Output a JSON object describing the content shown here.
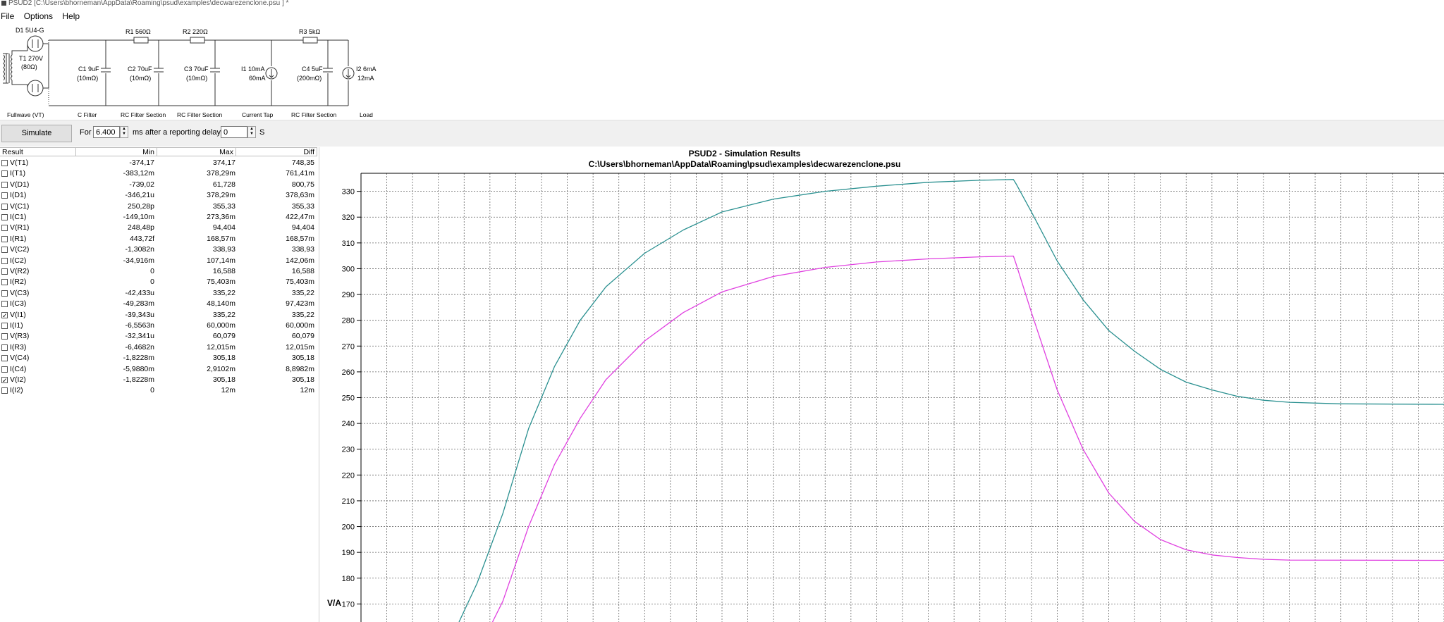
{
  "window": {
    "title": "PSUD2  [C:\\Users\\bhorneman\\AppData\\Roaming\\psud\\examples\\decwarezenclone.psu ] *"
  },
  "menu": [
    "File",
    "Options",
    "Help"
  ],
  "schematic": {
    "components": {
      "d1": "D1 5U4-G",
      "t1_a": "T1 270V",
      "t1_b": "(80Ω)",
      "r1": "R1 560Ω",
      "r2": "R2 220Ω",
      "r3": "R3 5kΩ",
      "c1_a": "C1 9uF",
      "c1_b": "(10mΩ)",
      "c2_a": "C2 70uF",
      "c2_b": "(10mΩ)",
      "c3_a": "C3 70uF",
      "c3_b": "(10mΩ)",
      "i1_a": "I1 10mA",
      "i1_b": "60mA",
      "c4_a": "C4 5uF",
      "c4_b": "(200mΩ)",
      "i2_a": "I2 6mA",
      "i2_b": "12mA"
    },
    "sections": {
      "s1": "Fullwave (VT)",
      "s2": "C Filter",
      "s3": "RC Filter Section",
      "s4": "RC Filter Section",
      "s5": "Current Tap",
      "s6": "RC Filter Section",
      "s7": "Load"
    }
  },
  "toolbar": {
    "simulate_label": "Simulate",
    "for_label": "For",
    "duration": "6.400",
    "ms_label": "ms",
    "after_label": "after a reporting delay of",
    "delay": "0",
    "s_label": "S"
  },
  "results": {
    "headers": {
      "result": "Result",
      "min": "Min",
      "max": "Max",
      "diff": "Diff"
    },
    "rows": [
      {
        "name": "V(T1)",
        "min": "-374,17",
        "max": "374,17",
        "diff": "748,35",
        "checked": false
      },
      {
        "name": "I(T1)",
        "min": "-383,12m",
        "max": "378,29m",
        "diff": "761,41m",
        "checked": false
      },
      {
        "name": "V(D1)",
        "min": "-739,02",
        "max": "61,728",
        "diff": "800,75",
        "checked": false
      },
      {
        "name": "I(D1)",
        "min": "-346,21u",
        "max": "378,29m",
        "diff": "378,63m",
        "checked": false
      },
      {
        "name": "V(C1)",
        "min": "250,28p",
        "max": "355,33",
        "diff": "355,33",
        "checked": false
      },
      {
        "name": "I(C1)",
        "min": "-149,10m",
        "max": "273,36m",
        "diff": "422,47m",
        "checked": false
      },
      {
        "name": "V(R1)",
        "min": "248,48p",
        "max": "94,404",
        "diff": "94,404",
        "checked": false
      },
      {
        "name": "I(R1)",
        "min": "443,72f",
        "max": "168,57m",
        "diff": "168,57m",
        "checked": false
      },
      {
        "name": "V(C2)",
        "min": "-1,3082n",
        "max": "338,93",
        "diff": "338,93",
        "checked": false
      },
      {
        "name": "I(C2)",
        "min": "-34,916m",
        "max": "107,14m",
        "diff": "142,06m",
        "checked": false
      },
      {
        "name": "V(R2)",
        "min": "0",
        "max": "16,588",
        "diff": "16,588",
        "checked": false
      },
      {
        "name": "I(R2)",
        "min": "0",
        "max": "75,403m",
        "diff": "75,403m",
        "checked": false
      },
      {
        "name": "V(C3)",
        "min": "-42,433u",
        "max": "335,22",
        "diff": "335,22",
        "checked": false
      },
      {
        "name": "I(C3)",
        "min": "-49,283m",
        "max": "48,140m",
        "diff": "97,423m",
        "checked": false
      },
      {
        "name": "V(I1)",
        "min": "-39,343u",
        "max": "335,22",
        "diff": "335,22",
        "checked": true
      },
      {
        "name": "I(I1)",
        "min": "-6,5563n",
        "max": "60,000m",
        "diff": "60,000m",
        "checked": false
      },
      {
        "name": "V(R3)",
        "min": "-32,341u",
        "max": "60,079",
        "diff": "60,079",
        "checked": false
      },
      {
        "name": "I(R3)",
        "min": "-6,4682n",
        "max": "12,015m",
        "diff": "12,015m",
        "checked": false
      },
      {
        "name": "V(C4)",
        "min": "-1,8228m",
        "max": "305,18",
        "diff": "305,18",
        "checked": false
      },
      {
        "name": "I(C4)",
        "min": "-5,9880m",
        "max": "2,9102m",
        "diff": "8,8982m",
        "checked": false
      },
      {
        "name": "V(I2)",
        "min": "-1,8228m",
        "max": "305,18",
        "diff": "305,18",
        "checked": true
      },
      {
        "name": "I(I2)",
        "min": "0",
        "max": "12m",
        "diff": "12m",
        "checked": false
      }
    ]
  },
  "plot": {
    "title": "PSUD2 - Simulation Results",
    "subtitle": "C:\\Users\\bhorneman\\AppData\\Roaming\\psud\\examples\\decwarezenclone.psu",
    "ylabel": "V/A"
  },
  "chart_data": {
    "type": "line",
    "title": "PSUD2 - Simulation Results",
    "subtitle": "C:\\Users\\bhorneman\\AppData\\Roaming\\psud\\examples\\decwarezenclone.psu",
    "ylabel": "V/A",
    "xlabel": "",
    "ylim": [
      163,
      337
    ],
    "y_ticks": [
      170,
      180,
      190,
      200,
      210,
      220,
      230,
      240,
      250,
      260,
      270,
      280,
      290,
      300,
      310,
      320,
      330
    ],
    "x_unit_note": "",
    "grid": true,
    "xlim": [
      0,
      42
    ],
    "series": [
      {
        "name": "V(I1)",
        "color": "#2a9090",
        "points": [
          [
            3.8,
            163
          ],
          [
            4.5,
            178
          ],
          [
            5.5,
            205
          ],
          [
            6.5,
            238
          ],
          [
            7.5,
            262
          ],
          [
            8.5,
            280
          ],
          [
            9.5,
            293
          ],
          [
            11,
            306
          ],
          [
            12.5,
            315
          ],
          [
            14,
            322
          ],
          [
            16,
            327
          ],
          [
            18,
            330
          ],
          [
            20,
            332
          ],
          [
            22,
            333.5
          ],
          [
            24,
            334.3
          ],
          [
            25.3,
            334.6
          ],
          [
            25.4,
            333
          ],
          [
            26,
            322
          ],
          [
            27,
            303
          ],
          [
            28,
            288
          ],
          [
            29,
            276
          ],
          [
            30,
            268
          ],
          [
            31,
            261
          ],
          [
            32,
            256
          ],
          [
            33,
            253
          ],
          [
            34,
            250.5
          ],
          [
            35,
            249
          ],
          [
            36,
            248.2
          ],
          [
            38,
            247.6
          ],
          [
            42,
            247.4
          ]
        ]
      },
      {
        "name": "V(I2)",
        "color": "#e040e0",
        "points": [
          [
            5.1,
            163
          ],
          [
            5.5,
            171
          ],
          [
            6.5,
            200
          ],
          [
            7.5,
            224
          ],
          [
            8.5,
            242
          ],
          [
            9.5,
            257
          ],
          [
            11,
            272
          ],
          [
            12.5,
            283
          ],
          [
            14,
            291
          ],
          [
            16,
            297
          ],
          [
            18,
            300.5
          ],
          [
            20,
            302.6
          ],
          [
            22,
            303.8
          ],
          [
            24,
            304.6
          ],
          [
            25.3,
            304.9
          ],
          [
            25.4,
            302
          ],
          [
            26,
            283
          ],
          [
            27,
            253
          ],
          [
            28,
            230
          ],
          [
            29,
            213
          ],
          [
            30,
            202
          ],
          [
            31,
            195
          ],
          [
            32,
            191
          ],
          [
            33,
            189
          ],
          [
            34,
            188
          ],
          [
            35,
            187.3
          ],
          [
            36,
            187
          ],
          [
            42,
            186.9
          ]
        ]
      }
    ]
  }
}
